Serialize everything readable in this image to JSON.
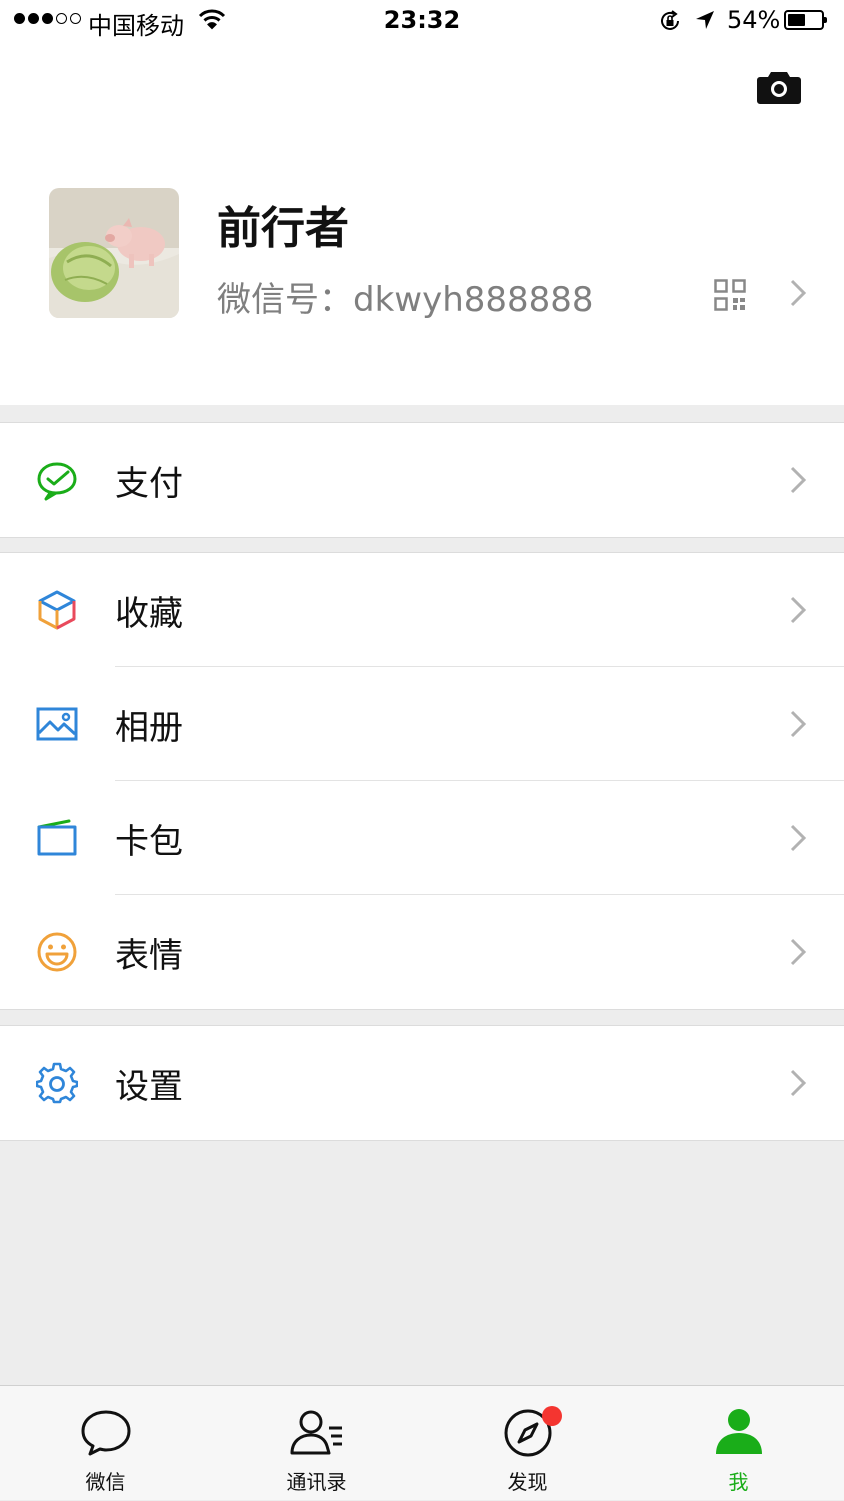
{
  "status_bar": {
    "carrier": "中国移动",
    "time": "23:32",
    "battery": "54%",
    "battery_level": 0.54,
    "signal_bars": 3
  },
  "profile": {
    "name": "前行者",
    "wechat_id": "微信号：dkwyh888888"
  },
  "menu": {
    "pay": "支付",
    "favorites": "收藏",
    "album": "相册",
    "cards": "卡包",
    "stickers": "表情",
    "settings": "设置"
  },
  "tabbar": {
    "chats": "微信",
    "contacts": "通讯录",
    "discover": "发现",
    "me": "我",
    "active_color": "#1aad19",
    "badge_color": "#f43530"
  },
  "colors": {
    "pay_icon": "#1aad19",
    "album_icon": "#2f86d9",
    "cards_icon": "#2f86d9",
    "stickers_icon": "#f0a13a",
    "settings_icon": "#2f86d9"
  }
}
